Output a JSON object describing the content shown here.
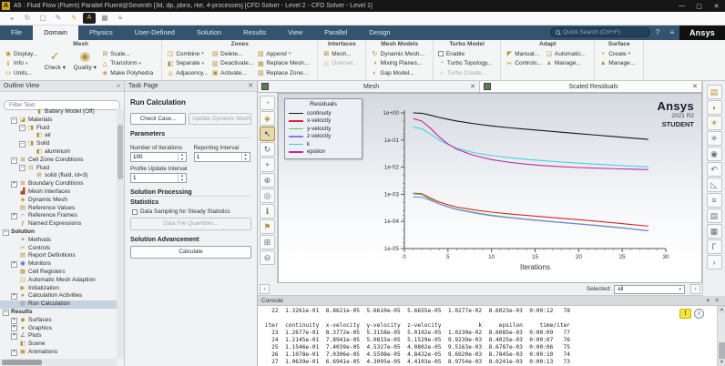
{
  "window": {
    "title": "A5 : Fluid Flow (Fluent) Parallel Fluent@Seventh [3d, dp, pbns, rke, 4-processes] [CFD Solver - Level 2 - CFD Solver - Level 1]",
    "controls": {
      "minimize": "—",
      "maximize": "▢",
      "close": "✕"
    }
  },
  "quickbar": {
    "icons": [
      {
        "name": "save-icon",
        "glyph": "◒",
        "style": "plain"
      },
      {
        "name": "refresh-icon",
        "glyph": "↻",
        "style": "plain"
      },
      {
        "name": "copy-screen-icon",
        "glyph": "▢",
        "style": "plain"
      },
      {
        "name": "pencil-icon",
        "glyph": "✎",
        "style": "plain"
      },
      {
        "name": "lightning-icon",
        "glyph": "ϟ",
        "style": "gold"
      },
      {
        "name": "ansys-app-icon",
        "glyph": "A",
        "style": "dark"
      },
      {
        "name": "grid-icon",
        "glyph": "▦",
        "style": "plain"
      },
      {
        "name": "layout-icon",
        "glyph": "≡",
        "style": "plain"
      }
    ]
  },
  "menu": {
    "tabs": [
      {
        "label": "File",
        "active": false
      },
      {
        "label": "Domain",
        "active": true
      },
      {
        "label": "Physics",
        "active": false
      },
      {
        "label": "User-Defined",
        "active": false
      },
      {
        "label": "Solution",
        "active": false
      },
      {
        "label": "Results",
        "active": false
      },
      {
        "label": "View",
        "active": false
      },
      {
        "label": "Parallel",
        "active": false
      },
      {
        "label": "Design",
        "active": false
      }
    ],
    "search_placeholder": "Quick Search (Ctrl+F)",
    "help_icon": "?",
    "list_icon": "≡",
    "brand": "Ansys"
  },
  "ribbon": {
    "groups": [
      {
        "title": "Mesh",
        "cells": [
          {
            "type": "col",
            "items": [
              {
                "label": "Display...",
                "glyph": "◉",
                "name": "display"
              },
              {
                "label": "Info",
                "glyph": "ℹ",
                "name": "info",
                "caret": true
              },
              {
                "label": "Units...",
                "glyph": "▭",
                "name": "units"
              }
            ]
          },
          {
            "type": "big",
            "label": "Check",
            "glyph": "✓",
            "name": "check",
            "caret": true
          },
          {
            "type": "big",
            "label": "Quality",
            "glyph": "◉",
            "name": "quality",
            "caret": true
          },
          {
            "type": "col",
            "items": [
              {
                "label": "Scale...",
                "glyph": "⊞",
                "name": "scale"
              },
              {
                "label": "Transform",
                "glyph": "△",
                "name": "transform",
                "caret": true
              },
              {
                "label": "Make Polyhedra",
                "glyph": "◈",
                "name": "make-polyhedra"
              }
            ]
          }
        ]
      },
      {
        "title": "Zones",
        "cells": [
          {
            "type": "col",
            "items": [
              {
                "label": "Combine",
                "glyph": "◫",
                "name": "combine",
                "caret": true
              },
              {
                "label": "Separate",
                "glyph": "◧",
                "name": "separate",
                "caret": true
              },
              {
                "label": "Adjacency...",
                "glyph": "◬",
                "name": "adjacency"
              }
            ]
          },
          {
            "type": "col",
            "items": [
              {
                "label": "Delete...",
                "glyph": "▤",
                "name": "delete"
              },
              {
                "label": "Deactivate...",
                "glyph": "▥",
                "name": "deactivate"
              },
              {
                "label": "Activate...",
                "glyph": "▣",
                "name": "activate"
              }
            ]
          },
          {
            "type": "col",
            "items": [
              {
                "label": "Append",
                "glyph": "▧",
                "name": "append",
                "caret": true
              },
              {
                "label": "Replace Mesh...",
                "glyph": "▩",
                "name": "replace-mesh"
              },
              {
                "label": "Replace Zone...",
                "glyph": "▨",
                "name": "replace-zone"
              }
            ]
          }
        ]
      },
      {
        "title": "Interfaces",
        "cells": [
          {
            "type": "col",
            "items": [
              {
                "label": "Mesh...",
                "glyph": "⊠",
                "name": "interfaces-mesh"
              },
              {
                "label": "Overset...",
                "glyph": "▦",
                "name": "overset",
                "disabled": true
              }
            ]
          }
        ]
      },
      {
        "title": "Mesh Models",
        "cells": [
          {
            "type": "col",
            "items": [
              {
                "label": "Dynamic Mesh...",
                "glyph": "↻",
                "name": "dynamic-mesh"
              },
              {
                "label": "Mixing Planes...",
                "glyph": "◑",
                "name": "mixing-planes"
              },
              {
                "label": "Gap Model...",
                "glyph": "◐",
                "name": "gap-model"
              }
            ]
          }
        ]
      },
      {
        "title": "Turbo Model",
        "cells": [
          {
            "type": "col",
            "items": [
              {
                "label": "Enable",
                "glyph": "",
                "name": "turbo-enable",
                "checkbox": true
              },
              {
                "label": "Turbo Topology...",
                "glyph": "◔",
                "name": "turbo-topology"
              },
              {
                "label": "Turbo Create...",
                "glyph": "◕",
                "name": "turbo-create",
                "disabled": true
              }
            ]
          }
        ]
      },
      {
        "title": "Adapt",
        "cells": [
          {
            "type": "col",
            "items": [
              {
                "label": "Manual...",
                "glyph": "◤",
                "name": "adapt-manual"
              },
              {
                "label": "Controls...",
                "glyph": "✂",
                "name": "adapt-controls"
              }
            ]
          },
          {
            "type": "col",
            "items": [
              {
                "label": "Automatic...",
                "glyph": "◲",
                "name": "adapt-automatic"
              },
              {
                "label": "Manage...",
                "glyph": "▲",
                "name": "adapt-manage"
              }
            ]
          }
        ]
      },
      {
        "title": "Surface",
        "cells": [
          {
            "type": "col",
            "items": [
              {
                "label": "Create",
                "glyph": "+",
                "name": "surface-create",
                "caret": true
              },
              {
                "label": "Manage...",
                "glyph": "▲",
                "name": "surface-manage"
              }
            ]
          }
        ]
      }
    ]
  },
  "outline": {
    "header": "Outline View",
    "collapse_icon": "«",
    "filter_placeholder": "Filter Text",
    "tree": [
      {
        "label": "Battery Model (Off)",
        "level": 3,
        "exp": "none",
        "glyph": "▮",
        "color": "#b8912f"
      },
      {
        "label": "Materials",
        "level": 1,
        "exp": "minus",
        "glyph": "◪",
        "color": "#b8912f"
      },
      {
        "label": "Fluid",
        "level": 2,
        "exp": "minus",
        "glyph": "◨",
        "color": "#b8912f"
      },
      {
        "label": "air",
        "level": 3,
        "exp": "none",
        "glyph": "◧",
        "color": "#b8912f"
      },
      {
        "label": "Solid",
        "level": 2,
        "exp": "minus",
        "glyph": "◨",
        "color": "#b8912f"
      },
      {
        "label": "aluminum",
        "level": 3,
        "exp": "none",
        "glyph": "◧",
        "color": "#b8912f"
      },
      {
        "label": "Cell Zone Conditions",
        "level": 1,
        "exp": "minus",
        "glyph": "⊞",
        "color": "#b8912f"
      },
      {
        "label": "Fluid",
        "level": 2,
        "exp": "minus",
        "glyph": "⊟",
        "color": "#b8912f"
      },
      {
        "label": "solid (fluid, id=3)",
        "level": 3,
        "exp": "none",
        "glyph": "⊞",
        "color": "#b8912f"
      },
      {
        "label": "Boundary Conditions",
        "level": 1,
        "exp": "plus",
        "glyph": "⊞",
        "color": "#b8912f"
      },
      {
        "label": "Mesh Interfaces",
        "level": 1,
        "exp": "none",
        "glyph": "▟",
        "color": "#b0482f"
      },
      {
        "label": "Dynamic Mesh",
        "level": 1,
        "exp": "none",
        "glyph": "◈",
        "color": "#b8912f"
      },
      {
        "label": "Reference Values",
        "level": 1,
        "exp": "none",
        "glyph": "▤",
        "color": "#b8912f"
      },
      {
        "label": "Reference Frames",
        "level": 1,
        "exp": "plus",
        "glyph": "⌐",
        "color": "#5572a0"
      },
      {
        "label": "Named Expressions",
        "level": 1,
        "exp": "none",
        "glyph": "ƒ",
        "color": "#8a6d1f"
      },
      {
        "label": "Solution",
        "level": 0,
        "exp": "minus",
        "glyph": "",
        "bold": true
      },
      {
        "label": "Methods",
        "level": 1,
        "exp": "none",
        "glyph": "✦",
        "color": "#b8912f"
      },
      {
        "label": "Controls",
        "level": 1,
        "exp": "none",
        "glyph": "✂",
        "color": "#b8912f"
      },
      {
        "label": "Report Definitions",
        "level": 1,
        "exp": "none",
        "glyph": "▤",
        "color": "#b8912f"
      },
      {
        "label": "Monitors",
        "level": 1,
        "exp": "plus",
        "glyph": "◉",
        "color": "#5572a0"
      },
      {
        "label": "Cell Registers",
        "level": 1,
        "exp": "none",
        "glyph": "▦",
        "color": "#b8912f"
      },
      {
        "label": "Automatic Mesh Adaption",
        "level": 1,
        "exp": "none",
        "glyph": "◲",
        "color": "#b8912f"
      },
      {
        "label": "Initialization",
        "level": 1,
        "exp": "none",
        "glyph": "▶",
        "color": "#b8912f"
      },
      {
        "label": "Calculation Activities",
        "level": 1,
        "exp": "plus",
        "glyph": "●",
        "color": "#b8912f"
      },
      {
        "label": "Run Calculation",
        "level": 1,
        "exp": "none",
        "glyph": "◎",
        "color": "#6b6f73",
        "selected": true
      },
      {
        "label": "Results",
        "level": 0,
        "exp": "minus",
        "glyph": "",
        "bold": true
      },
      {
        "label": "Surfaces",
        "level": 1,
        "exp": "plus",
        "glyph": "◆",
        "color": "#b8912f"
      },
      {
        "label": "Graphics",
        "level": 1,
        "exp": "plus",
        "glyph": "●",
        "color": "#b8912f"
      },
      {
        "label": "Plots",
        "level": 1,
        "exp": "plus",
        "glyph": "∠",
        "color": "#5572a0"
      },
      {
        "label": "Scene",
        "level": 1,
        "exp": "none",
        "glyph": "◧",
        "color": "#b8912f"
      },
      {
        "label": "Animations",
        "level": 1,
        "exp": "plus",
        "glyph": "▣",
        "color": "#b8912f"
      }
    ]
  },
  "taskpage": {
    "header": "Task Page",
    "close_icon": "✕",
    "title": "Run Calculation",
    "check_case_btn": "Check Case...",
    "update_dynamic_mesh_btn": "Update Dynamic Mesh...",
    "parameters_label": "Parameters",
    "iterations_label": "Number of Iterations",
    "iterations_value": "100",
    "reporting_label": "Reporting Interval",
    "reporting_value": "1",
    "profile_label": "Profile Update Interval",
    "profile_value": "1",
    "solution_processing_label": "Solution Processing",
    "statistics_label": "Statistics",
    "sampling_checkbox_label": "Data Sampling for Steady Statistics",
    "data_file_btn": "Data File Quantities...",
    "solution_advancement_label": "Solution Advancement",
    "calculate_btn": "Calculate"
  },
  "graphics": {
    "tabs": [
      {
        "label": "Mesh",
        "close": "✕",
        "active": false
      },
      {
        "label": "Scaled Residuals",
        "close": "✕",
        "active": true
      }
    ],
    "toolbar_left": [
      {
        "name": "orbit-icon",
        "glyph": "◔",
        "gold": true
      },
      {
        "name": "probe-icon",
        "glyph": "◈",
        "gold": true
      },
      {
        "name": "pointer-icon",
        "glyph": "↖",
        "selected": true
      },
      {
        "name": "rotate-icon",
        "glyph": "↻"
      },
      {
        "name": "pan-icon",
        "glyph": "+"
      },
      {
        "name": "zoom-in-icon",
        "glyph": "⊕"
      },
      {
        "name": "magnifier-icon",
        "glyph": "◎"
      },
      {
        "name": "info-icon",
        "glyph": "ℹ"
      },
      {
        "name": "flag-icon",
        "glyph": "⚑",
        "gold": true
      },
      {
        "name": "zoom-box-icon",
        "glyph": "⊞"
      },
      {
        "name": "zoom-out-icon",
        "glyph": "⊖"
      }
    ],
    "toolbar_right": [
      {
        "name": "mesh-display-icon",
        "glyph": "▤",
        "gold": true
      },
      {
        "name": "hand-icon",
        "glyph": "◗",
        "gold": true
      },
      {
        "name": "highlight-icon",
        "glyph": "☀",
        "gold": true
      },
      {
        "name": "gear-icon",
        "glyph": "✳"
      },
      {
        "name": "eye-icon",
        "glyph": "◉"
      },
      {
        "name": "undo-icon",
        "glyph": "↶"
      },
      {
        "name": "plot-icon",
        "glyph": "◺"
      },
      {
        "name": "ruler-icon",
        "glyph": "≡"
      },
      {
        "name": "report-icon",
        "glyph": "▤"
      },
      {
        "name": "table-icon",
        "glyph": "▦"
      },
      {
        "name": "corner-icon",
        "glyph": "Γ"
      },
      {
        "name": "more-icon",
        "glyph": "›"
      }
    ],
    "selected_bar": {
      "label": "Selected:",
      "value": "all",
      "caret": "▾",
      "left_arrow": "‹",
      "right_arrow": "›"
    },
    "watermark": {
      "line1": "Ansys",
      "line2": "2021 R2",
      "line3": "STUDENT"
    }
  },
  "chart_data": {
    "type": "line",
    "title": "Scaled Residuals",
    "xlabel": "Iterations",
    "ylabel": "",
    "xlim": [
      0,
      30
    ],
    "ylim_log": [
      1e-05,
      1
    ],
    "x_ticks": [
      0,
      5,
      10,
      15,
      20,
      25,
      30
    ],
    "y_ticks": [
      "1e+00",
      "1e-01",
      "1e-02",
      "1e-03",
      "1e-04",
      "1e-05"
    ],
    "legend_title": "Residuals",
    "legend_position": "top-left",
    "grid": false,
    "x": [
      1,
      2,
      3,
      4,
      5,
      6,
      8,
      10,
      12,
      14,
      16,
      18,
      20,
      22,
      24,
      26,
      28
    ],
    "series": [
      {
        "name": "continuity",
        "color": "#16161d",
        "values": [
          1.0,
          0.97,
          0.82,
          0.68,
          0.58,
          0.5,
          0.4,
          0.33,
          0.285,
          0.25,
          0.22,
          0.195,
          0.172,
          0.152,
          0.135,
          0.119,
          0.106
        ]
      },
      {
        "name": "x-velocity",
        "color": "#dd2222",
        "values": [
          0.0011,
          0.00105,
          0.00072,
          0.00052,
          0.00041,
          0.00034,
          0.000265,
          0.00022,
          0.00019,
          0.000167,
          0.000147,
          0.00013,
          0.000116,
          0.000102,
          8.9e-05,
          7.7e-05,
          6.7e-05
        ]
      },
      {
        "name": "y-velocity",
        "color": "#3fd84f",
        "values": [
          0.00105,
          0.00098,
          0.00064,
          0.00045,
          0.00035,
          0.000285,
          0.000215,
          0.00017,
          0.000142,
          0.000122,
          0.000106,
          9.3e-05,
          8.2e-05,
          7.2e-05,
          6.3e-05,
          5.4e-05,
          4.6e-05
        ]
      },
      {
        "name": "z-velocity",
        "color": "#7d7de8",
        "values": [
          0.0008,
          0.00078,
          0.0006,
          0.00044,
          0.00034,
          0.000275,
          0.000205,
          0.000162,
          0.000137,
          0.000118,
          0.000103,
          9.1e-05,
          8e-05,
          7e-05,
          6.1e-05,
          5.3e-05,
          4.5e-05
        ]
      },
      {
        "name": "k",
        "color": "#3fd4e0",
        "values": [
          0.3,
          0.26,
          0.165,
          0.1,
          0.068,
          0.05,
          0.034,
          0.027,
          0.0225,
          0.0195,
          0.0172,
          0.0155,
          0.0141,
          0.0129,
          0.0119,
          0.011,
          0.0102
        ]
      },
      {
        "name": "epsilon",
        "color": "#c428a6",
        "values": [
          0.62,
          0.5,
          0.27,
          0.13,
          0.072,
          0.046,
          0.027,
          0.019,
          0.0151,
          0.0129,
          0.0114,
          0.0104,
          0.0097,
          0.0092,
          0.0088,
          0.0084,
          0.0081
        ]
      }
    ]
  },
  "console": {
    "header": "Console",
    "header_icons": "▾ ✕",
    "warning_icon": "!",
    "info_icon": "i",
    "lines": [
      "   22  1.3261e-01  8.8621e-05  5.6610e-05  5.6655e-05  1.0277e-02  8.6023e-03  0:00:12   78",
      "",
      " iter  continuity  x-velocity  y-velocity  z-velocity           k     epsilon     time/iter",
      "   23  1.2677e-01  8.3772e-05  5.3158e-05  5.0102e-05  1.0230e-02  8.6085e-03  0:00:09   77",
      "   24  1.2145e-01  7.8941e-05  5.0815e-05  5.1529e-05  9.9239e-03  8.4025e-03  0:00:07   76",
      "   25  1.1546e-01  7.4039e-05  4.5327e-05  4.0802e-05  9.5163e-03  8.6787e-03  0:00:06   75",
      "   26  1.1078e-01  7.0306e-05  4.5598e-05  4.8432e-05  9.6920e-03  8.7845e-03  0:00:10   74",
      "   27  1.0639e-01  6.6941e-05  4.3095e-05  4.4103e-05  8.9754e-03  8.0241e-03  0:00:13   73"
    ]
  }
}
